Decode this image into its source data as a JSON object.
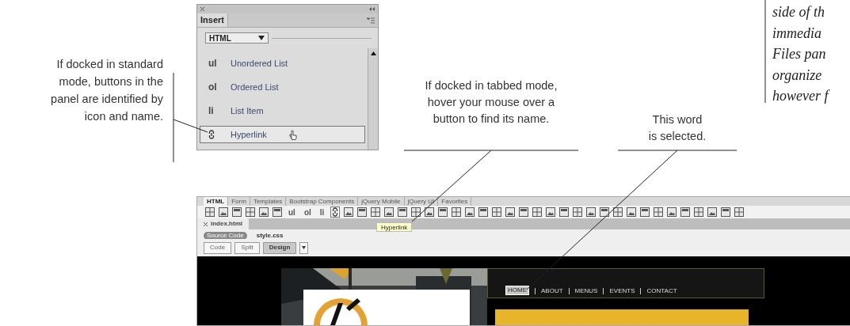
{
  "insert_panel": {
    "tab": "Insert",
    "category": "HTML",
    "items": [
      {
        "icon": "ul",
        "label": "Unordered List",
        "selected": false
      },
      {
        "icon": "ol",
        "label": "Ordered List",
        "selected": false
      },
      {
        "icon": "li",
        "label": "List Item",
        "selected": false
      },
      {
        "label": "Hyperlink",
        "selected": true
      }
    ]
  },
  "callouts": [
    {
      "lines": [
        "If docked in standard",
        "mode, buttons in the",
        "panel are identified by",
        "icon and name."
      ]
    },
    {
      "lines": [
        "If docked in tabbed mode,",
        "hover your mouse over a",
        "button to find its name."
      ]
    },
    {
      "lines": [
        "This word",
        "is selected."
      ]
    }
  ],
  "body_text_lines": [
    "side of th",
    "immedia",
    "Files pan",
    "organize",
    "however f"
  ],
  "editor": {
    "toolbar_tabs": [
      {
        "label": "HTML",
        "selected": true
      },
      {
        "label": "Form",
        "selected": false
      },
      {
        "label": "Templates",
        "selected": false
      },
      {
        "label": "Bootstrap Components",
        "selected": false
      },
      {
        "label": "jQuery Mobile",
        "selected": false
      },
      {
        "label": "jQuery UI",
        "selected": false
      },
      {
        "label": "Favorites",
        "selected": false
      }
    ],
    "text_buttons": [
      "ul",
      "ol",
      "li"
    ],
    "tooltip": "Hyperlink",
    "document_tab": "index.html",
    "related_files": [
      {
        "label": "Source Code",
        "selected": true
      },
      {
        "label": "style.css",
        "selected": false
      }
    ],
    "view_buttons": [
      {
        "label": "Code",
        "selected": false
      },
      {
        "label": "Split",
        "selected": false
      },
      {
        "label": "Design",
        "selected": true
      }
    ],
    "nav": [
      {
        "label": "HOME",
        "selected": true
      },
      {
        "label": "ABOUT",
        "selected": false
      },
      {
        "label": "MENUS",
        "selected": false
      },
      {
        "label": "EVENTS",
        "selected": false
      },
      {
        "label": "CONTACT",
        "selected": false
      }
    ]
  }
}
